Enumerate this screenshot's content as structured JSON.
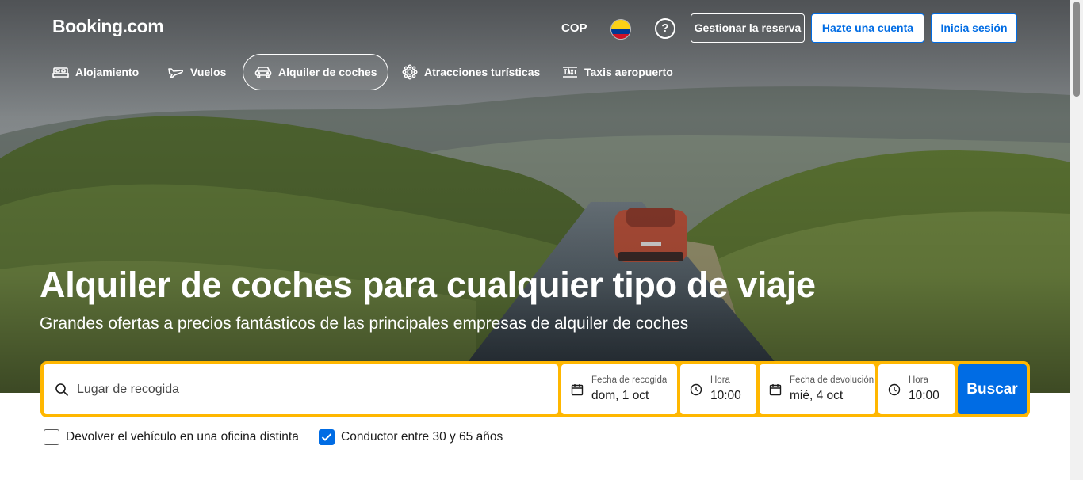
{
  "header": {
    "logo": "Booking.com",
    "currency": "COP",
    "help_symbol": "?",
    "manage_booking": "Gestionar la reserva",
    "create_account": "Hazte una cuenta",
    "sign_in": "Inicia sesión"
  },
  "nav": {
    "items": [
      {
        "label": "Alojamiento",
        "icon": "bed-icon"
      },
      {
        "label": "Vuelos",
        "icon": "plane-icon"
      },
      {
        "label": "Alquiler de coches",
        "icon": "car-icon",
        "active": true
      },
      {
        "label": "Atracciones turísticas",
        "icon": "attractions-icon"
      },
      {
        "label": "Taxis aeropuerto",
        "icon": "taxi-icon"
      }
    ]
  },
  "hero": {
    "title": "Alquiler de coches para cualquier tipo de viaje",
    "subtitle": "Grandes ofertas a precios fantásticos de las principales empresas de alquiler de coches"
  },
  "search": {
    "pickup_placeholder": "Lugar de recogida",
    "pickup_date_label": "Fecha de recogida",
    "pickup_date_value": "dom, 1 oct",
    "pickup_time_label": "Hora",
    "pickup_time_value": "10:00",
    "dropoff_date_label": "Fecha de devolución",
    "dropoff_date_value": "mié, 4 oct",
    "dropoff_time_label": "Hora",
    "dropoff_time_value": "10:00",
    "submit_label": "Buscar"
  },
  "options": {
    "different_return": {
      "label": "Devolver el vehículo en una oficina distinta",
      "checked": false
    },
    "driver_age": {
      "label": "Conductor entre 30 y 65 años",
      "checked": true
    }
  },
  "colors": {
    "brand_blue": "#006ce4",
    "search_border": "#ffb700"
  }
}
